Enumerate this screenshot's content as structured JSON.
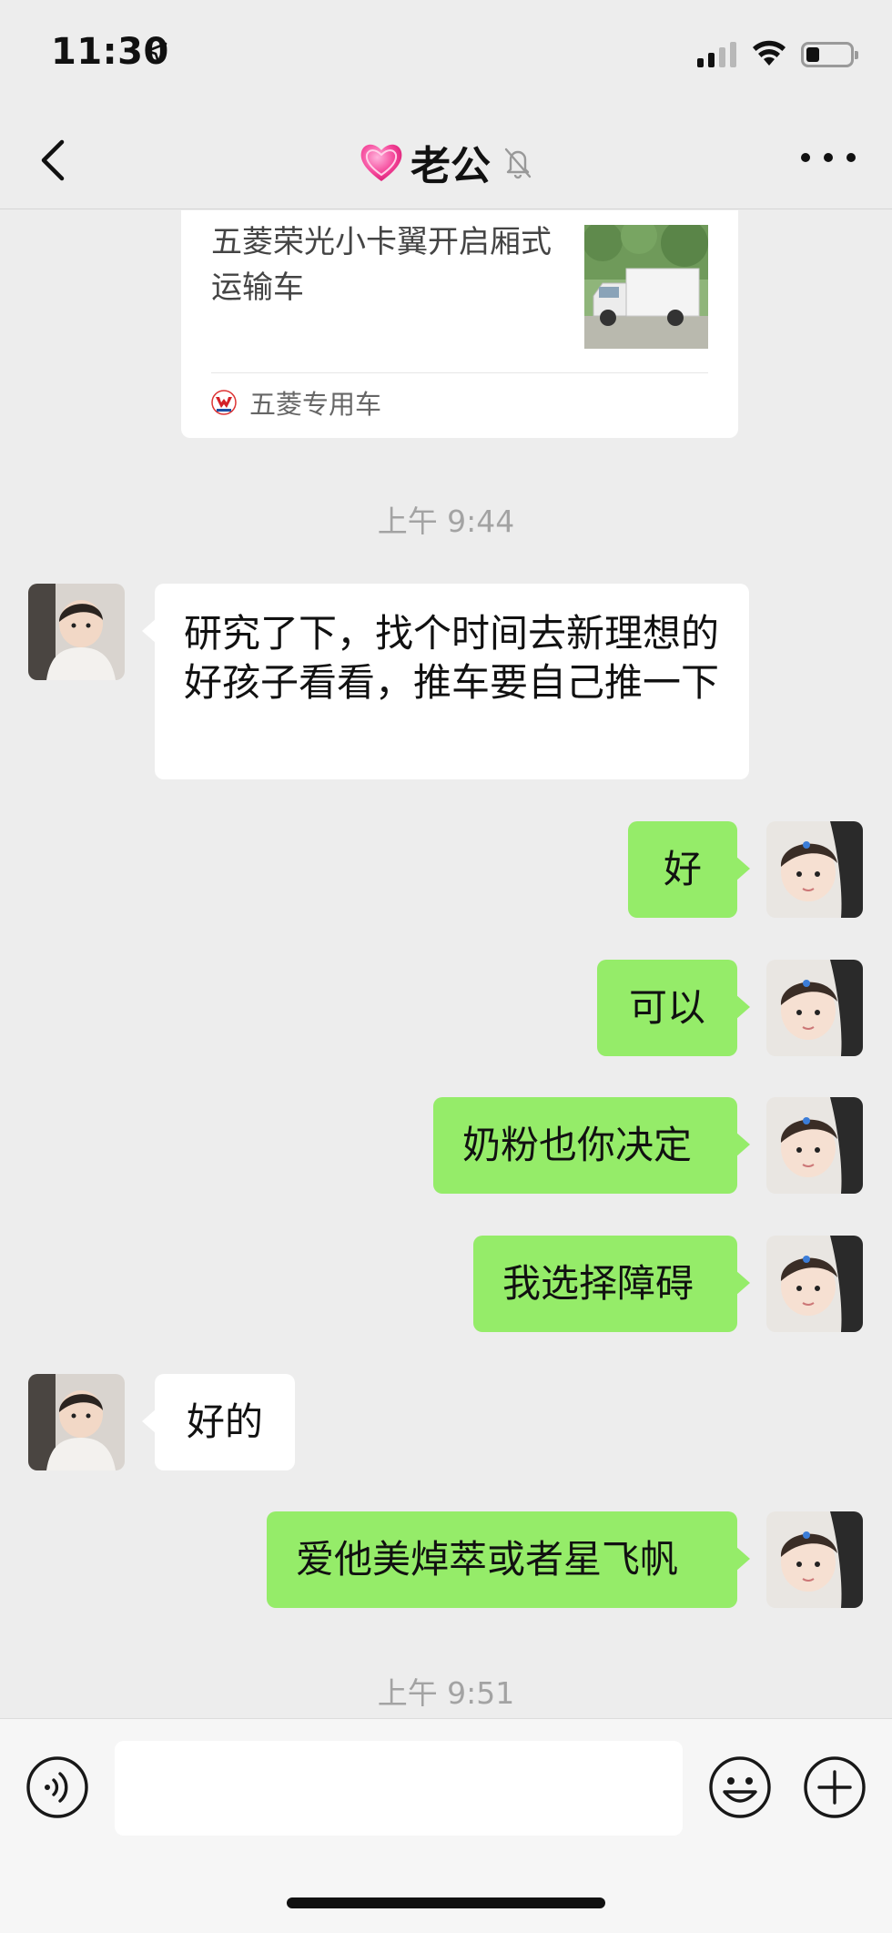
{
  "status_bar": {
    "time": "11:30"
  },
  "header": {
    "title": "老公",
    "title_prefix_icon": "pink-heart-emoji",
    "muted_icon": "bell-slash"
  },
  "link_card": {
    "title": "五菱荣光小卡翼开启厢式运输车",
    "source": "五菱专用车"
  },
  "timestamps": [
    "上午 9:44",
    "上午 9:51"
  ],
  "messages": [
    {
      "side": "in",
      "text": "研究了下，找个时间去新理想的好孩子看看，推车要自己推一下"
    },
    {
      "side": "out",
      "text": "好"
    },
    {
      "side": "out",
      "text": "可以"
    },
    {
      "side": "out",
      "text": "奶粉也你决定"
    },
    {
      "side": "out",
      "text": "我选择障碍"
    },
    {
      "side": "in",
      "text": "好的"
    },
    {
      "side": "out",
      "text": "爱他美焯萃或者星飞帆"
    }
  ],
  "input_bar": {
    "placeholder": ""
  },
  "colors": {
    "background": "#ededed",
    "outgoing_bubble": "#95ec69",
    "incoming_bubble": "#ffffff"
  }
}
